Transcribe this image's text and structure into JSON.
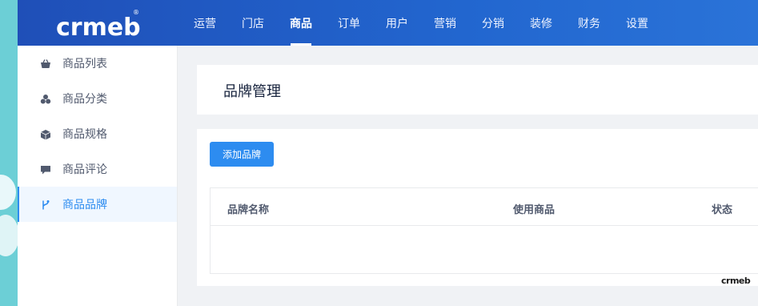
{
  "brand": {
    "logo_text": "crmeb",
    "registered_mark": "®",
    "accent": "#2d8cf0",
    "topbar_color": "#1f4fb8"
  },
  "nav": {
    "items": [
      {
        "label": "运营"
      },
      {
        "label": "门店"
      },
      {
        "label": "商品"
      },
      {
        "label": "订单"
      },
      {
        "label": "用户"
      },
      {
        "label": "营销"
      },
      {
        "label": "分销"
      },
      {
        "label": "装修"
      },
      {
        "label": "财务"
      },
      {
        "label": "设置"
      }
    ],
    "active_index": 2
  },
  "sidebar": {
    "items": [
      {
        "label": "商品列表",
        "icon": "basket-icon"
      },
      {
        "label": "商品分类",
        "icon": "cluster-icon"
      },
      {
        "label": "商品规格",
        "icon": "cube-icon"
      },
      {
        "label": "商品评论",
        "icon": "comment-icon"
      },
      {
        "label": "商品品牌",
        "icon": "branch-icon"
      }
    ],
    "active_index": 4
  },
  "page": {
    "title": "品牌管理"
  },
  "toolbar": {
    "add_label": "添加品牌"
  },
  "table": {
    "columns": [
      "品牌名称",
      "使用商品",
      "状态"
    ],
    "rows": []
  },
  "watermark": {
    "text": "crmeb"
  }
}
